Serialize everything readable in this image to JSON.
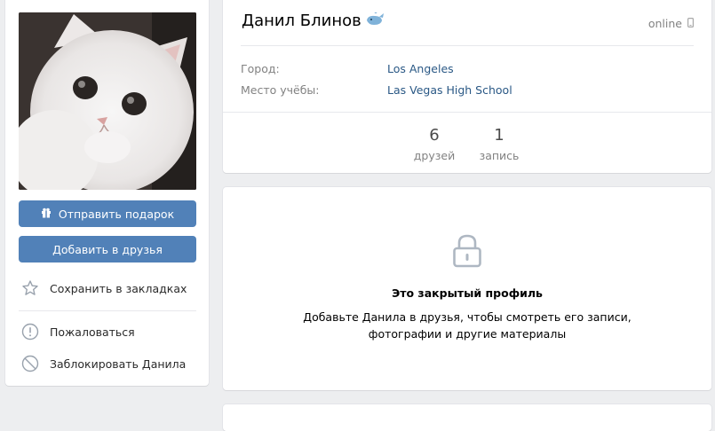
{
  "profile": {
    "name": "Данил Блинов",
    "status": "online",
    "info": [
      {
        "label": "Город:",
        "value": "Los Angeles"
      },
      {
        "label": "Место учёбы:",
        "value": "Las Vegas High School"
      }
    ],
    "counters": [
      {
        "value": "6",
        "label": "друзей"
      },
      {
        "value": "1",
        "label": "запись"
      }
    ]
  },
  "sidebar": {
    "gift_button": "Отправить подарок",
    "add_friend_button": "Добавить в друзья",
    "actions": [
      {
        "label": "Сохранить в закладках",
        "icon": "star-icon"
      },
      {
        "label": "Пожаловаться",
        "icon": "exclamation-circle-icon"
      },
      {
        "label": "Заблокировать Данила",
        "icon": "block-icon"
      }
    ]
  },
  "private_profile": {
    "title": "Это закрытый профиль",
    "line1": "Добавьте Данила в друзья, чтобы смотреть его записи,",
    "line2": "фотографии и другие материалы"
  },
  "colors": {
    "button": "#5181b8",
    "link": "#2a5885",
    "background": "#edeef0"
  }
}
